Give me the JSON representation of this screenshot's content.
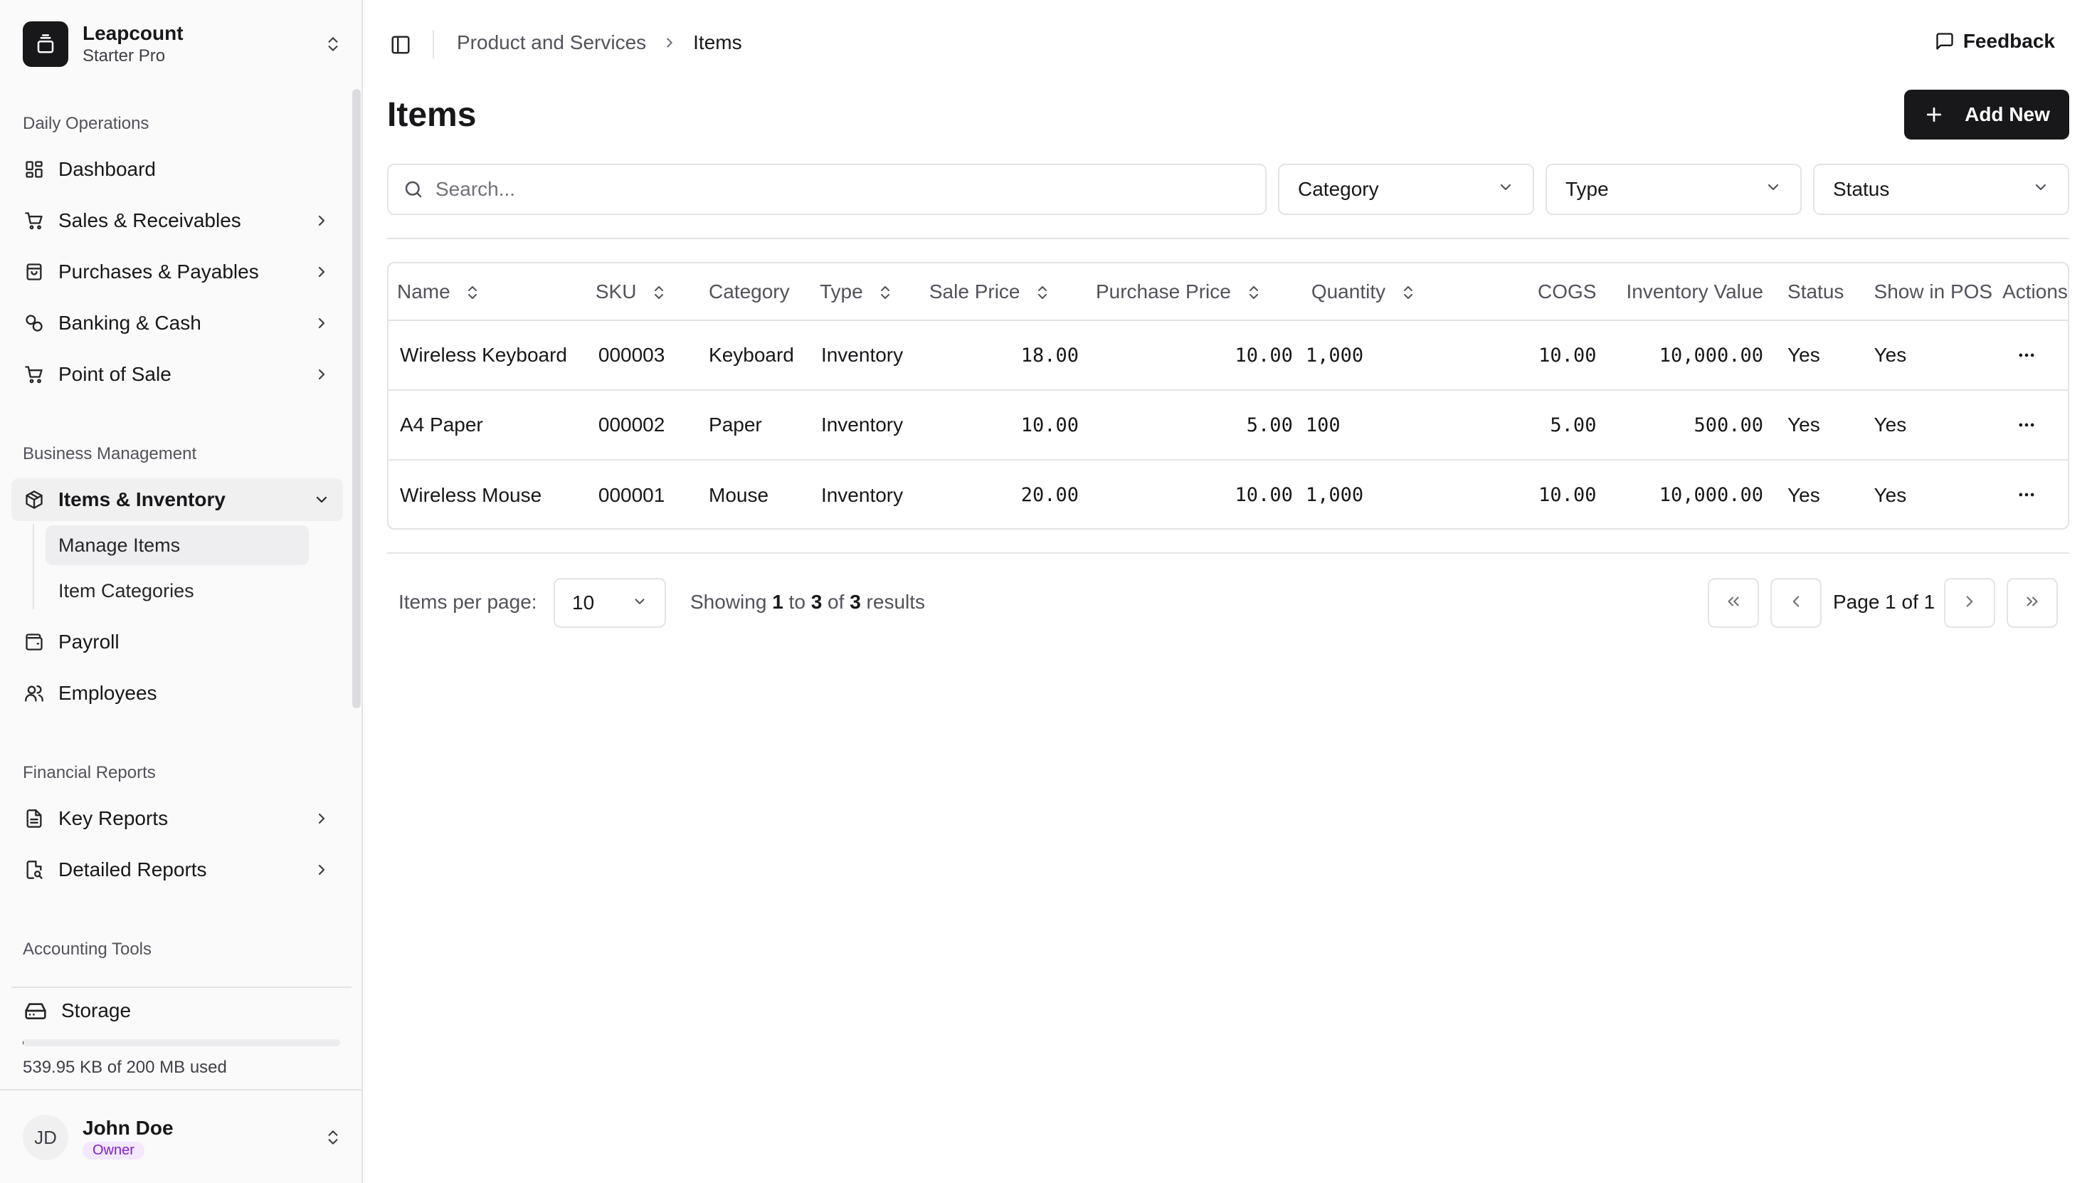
{
  "workspace": {
    "name": "Leapcount",
    "plan": "Starter Pro"
  },
  "sidebar": {
    "sections": [
      {
        "label": "Daily Operations"
      },
      {
        "label": "Business Management"
      },
      {
        "label": "Financial Reports"
      },
      {
        "label": "Accounting Tools"
      }
    ],
    "items": [
      {
        "label": "Dashboard",
        "icon": "dashboard-icon"
      },
      {
        "label": "Sales & Receivables",
        "icon": "cart-icon"
      },
      {
        "label": "Purchases & Payables",
        "icon": "shopping-bag-icon"
      },
      {
        "label": "Banking & Cash",
        "icon": "banking-icon"
      },
      {
        "label": "Point of Sale",
        "icon": "cart-icon"
      },
      {
        "label": "Items & Inventory",
        "icon": "package-icon",
        "expanded": true
      },
      {
        "label": "Payroll",
        "icon": "wallet-icon"
      },
      {
        "label": "Employees",
        "icon": "users-icon"
      },
      {
        "label": "Key Reports",
        "icon": "file-text-icon"
      },
      {
        "label": "Detailed Reports",
        "icon": "file-search-icon"
      }
    ],
    "subitems": [
      {
        "label": "Manage Items",
        "active": true
      },
      {
        "label": "Item Categories"
      }
    ],
    "storage": {
      "label": "Storage",
      "usage_text": "539.95 KB of 200 MB used",
      "used_fraction": 0.0027
    },
    "user": {
      "initials": "JD",
      "name": "John Doe",
      "role": "Owner"
    }
  },
  "header": {
    "breadcrumb": {
      "parent": "Product and Services",
      "current": "Items"
    },
    "feedback_label": "Feedback"
  },
  "page": {
    "title": "Items",
    "add_label": "Add New",
    "search_placeholder": "Search...",
    "filters": {
      "category": "Category",
      "type": "Type",
      "status": "Status"
    }
  },
  "table": {
    "headers": {
      "name": "Name",
      "sku": "SKU",
      "category": "Category",
      "type": "Type",
      "sale_price": "Sale Price",
      "purchase_price": "Purchase Price",
      "quantity": "Quantity",
      "cogs": "COGS",
      "inventory_value": "Inventory Value",
      "status": "Status",
      "show_in_pos": "Show in POS",
      "actions": "Actions"
    },
    "rows": [
      {
        "name": "Wireless Keyboard",
        "sku": "000003",
        "category": "Keyboard",
        "type": "Inventory",
        "sale_price": "18.00",
        "purchase_price": "10.00",
        "quantity": "1,000",
        "cogs": "10.00",
        "inventory_value": "10,000.00",
        "status": "Yes",
        "show_in_pos": "Yes"
      },
      {
        "name": "A4 Paper",
        "sku": "000002",
        "category": "Paper",
        "type": "Inventory",
        "sale_price": "10.00",
        "purchase_price": "5.00",
        "quantity": "100",
        "cogs": "5.00",
        "inventory_value": "500.00",
        "status": "Yes",
        "show_in_pos": "Yes"
      },
      {
        "name": "Wireless Mouse",
        "sku": "000001",
        "category": "Mouse",
        "type": "Inventory",
        "sale_price": "20.00",
        "purchase_price": "10.00",
        "quantity": "1,000",
        "cogs": "10.00",
        "inventory_value": "10,000.00",
        "status": "Yes",
        "show_in_pos": "Yes"
      }
    ]
  },
  "pagination": {
    "per_page_label": "Items per page:",
    "per_page_value": "10",
    "showing_prefix": "Showing",
    "from": "1",
    "to_word": "to",
    "to": "3",
    "of_word": "of",
    "total": "3",
    "results_word": "results",
    "page_text": "Page 1 of 1"
  }
}
